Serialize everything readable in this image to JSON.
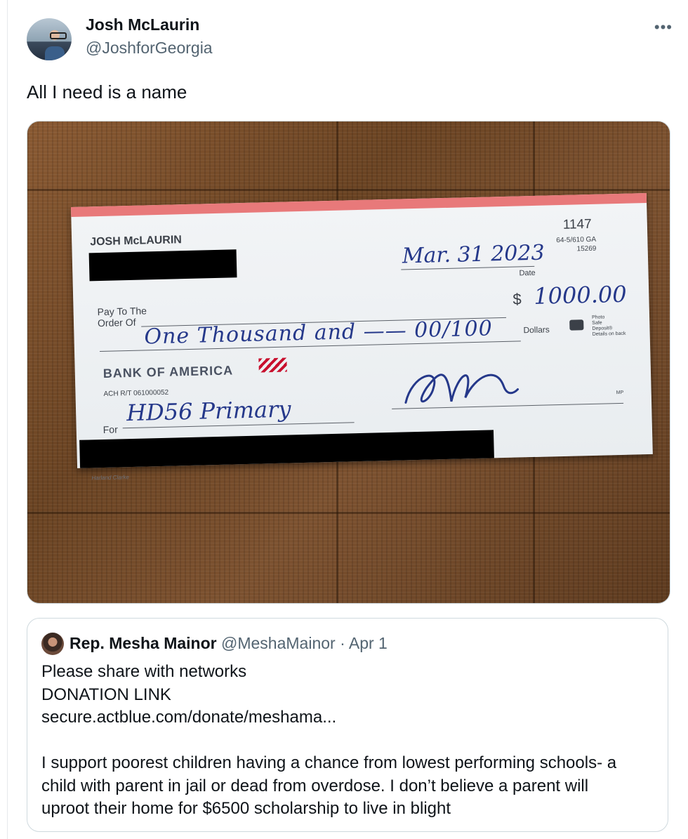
{
  "tweet": {
    "author": {
      "display_name": "Josh McLaurin",
      "handle": "@JoshforGeorgia"
    },
    "more_menu": "•••",
    "text": "All I need is a name"
  },
  "check": {
    "account_holder": "JOSH McLAURIN",
    "check_number": "1147",
    "fraction_code_line1": "64-5/610 GA",
    "fraction_code_line2": "15269",
    "date_value": "Mar. 31 2023",
    "date_label": "Date",
    "pay_to_label_line1": "Pay To The",
    "pay_to_label_line2": "Order Of",
    "dollar_sign": "$",
    "amount_numeric": "1000.00",
    "amount_written": "One Thousand and —— 00/100",
    "dollars_label": "Dollars",
    "photo_safe_line1": "Photo",
    "photo_safe_line2": "Safe",
    "photo_safe_line3": "Deposit®",
    "photo_safe_line4": "Details on back",
    "bank_name": "BANK OF AMERICA",
    "ach_routing": "ACH R/T 061000052",
    "memo_label": "For",
    "memo_value": "HD56 Primary",
    "mp_mark": "MP",
    "printer": "Harland Clarke"
  },
  "quoted_tweet": {
    "display_name": "Rep. Mesha Mainor",
    "handle": "@MeshaMainor",
    "separator": "·",
    "date": "Apr 1",
    "lines": [
      "Please share with networks",
      "DONATION LINK",
      "secure.actblue.com/donate/meshama...",
      "",
      "I support poorest children having a chance from lowest performing schools- a",
      "child with parent in jail or dead from overdose. I don’t believe a parent will",
      "uproot their home for $6500 scholarship to live in blight"
    ]
  }
}
